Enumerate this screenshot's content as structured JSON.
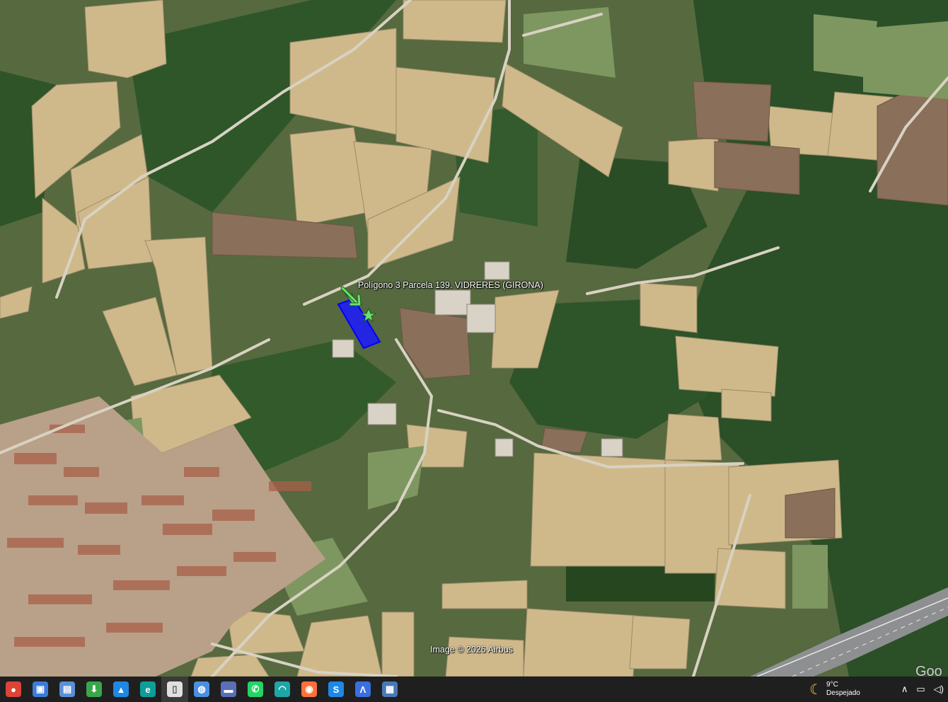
{
  "map": {
    "parcel_label": "Polígono 3 Parcela 139. VIDRERES (GIRONA)",
    "attribution": "Image © 2026 Airbus",
    "logo_fragment": "Goo"
  },
  "colors": {
    "parcel_fill": "#1a1aff",
    "pointer": "#5cd65c",
    "field": "#cdb88c",
    "forest": "#2f5a2a",
    "town_roofs": "#b89070",
    "taskbar": "#1f1f1f"
  },
  "taskbar": {
    "apps": [
      {
        "name": "chrome",
        "glyph": "●",
        "color": "#db4437"
      },
      {
        "name": "photos",
        "glyph": "▣",
        "color": "#3c7bd9"
      },
      {
        "name": "explorer-window",
        "glyph": "▤",
        "color": "#5b8fd6"
      },
      {
        "name": "installer",
        "glyph": "⬇",
        "color": "#3aa64c"
      },
      {
        "name": "image-viewer",
        "glyph": "▲",
        "color": "#1e88e5"
      },
      {
        "name": "edge",
        "glyph": "e",
        "color": "#0f9d9a"
      },
      {
        "name": "document",
        "glyph": "▯",
        "color": "#e0e0e0"
      },
      {
        "name": "earth",
        "glyph": "◍",
        "color": "#4a90e2"
      },
      {
        "name": "disk-save",
        "glyph": "▬",
        "color": "#5a6fb8"
      },
      {
        "name": "whatsapp",
        "glyph": "✆",
        "color": "#25d366"
      },
      {
        "name": "app-wave",
        "glyph": "◠",
        "color": "#1fa6a6"
      },
      {
        "name": "firefox",
        "glyph": "◉",
        "color": "#ff7139"
      },
      {
        "name": "app-s",
        "glyph": "S",
        "color": "#1e88e5"
      },
      {
        "name": "app-a",
        "glyph": "Λ",
        "color": "#3b6fe0"
      },
      {
        "name": "app-window",
        "glyph": "▦",
        "color": "#4a78b8"
      }
    ],
    "weather_temp": "9°C",
    "weather_desc": "Despejado",
    "chevron": "∧",
    "network": "▭",
    "volume": "◁)"
  }
}
